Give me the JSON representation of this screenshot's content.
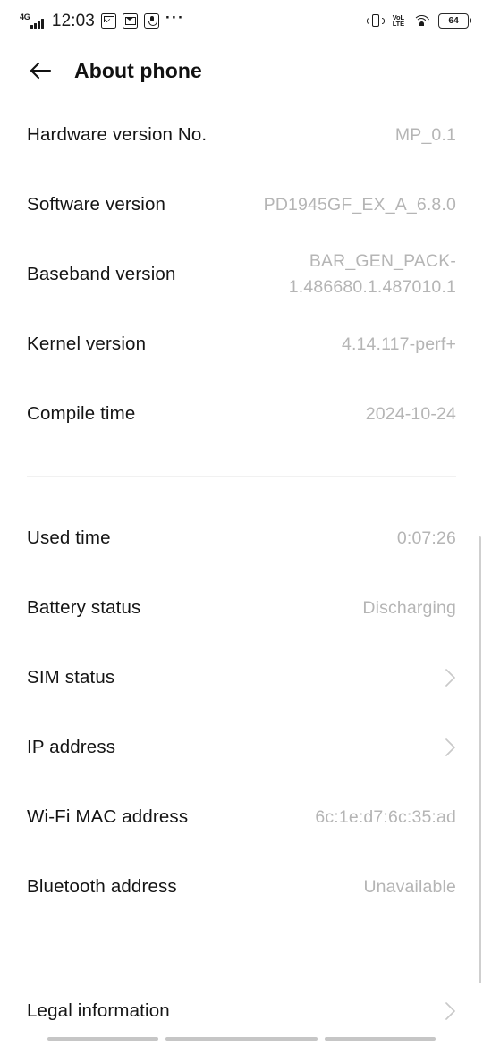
{
  "statusbar": {
    "network_label": "4G",
    "time": "12:03",
    "overflow": "···",
    "volte_top": "VoL",
    "volte_bottom": "LTE",
    "battery_level": "64",
    "icons": {
      "signal": "signal-bars-icon",
      "mail_unread": "mail-unread-icon",
      "mail_read": "mail-read-icon",
      "voice_recorder": "microphone-icon",
      "more": "more-notifications-icon",
      "vibrate": "vibrate-icon",
      "volte": "volte-icon",
      "wifi": "wifi-icon",
      "battery": "battery-icon"
    }
  },
  "appbar": {
    "back_label": "back-arrow",
    "title": "About phone"
  },
  "sections": [
    {
      "id": "version-info",
      "rows": [
        {
          "label": "Hardware version No.",
          "value": "MP_0.1",
          "type": "value"
        },
        {
          "label": "Software version",
          "value": "PD1945GF_EX_A_6.8.0",
          "type": "value"
        },
        {
          "label": "Baseband version",
          "value": "BAR_GEN_PACK-1.486680.1.487010.1",
          "type": "value",
          "wrap": true
        },
        {
          "label": "Kernel version",
          "value": "4.14.117-perf+",
          "type": "value"
        },
        {
          "label": "Compile time",
          "value": "2024-10-24",
          "type": "value"
        }
      ]
    },
    {
      "id": "device-status",
      "rows": [
        {
          "label": "Used time",
          "value": "0:07:26",
          "type": "value"
        },
        {
          "label": "Battery status",
          "value": "Discharging",
          "type": "value"
        },
        {
          "label": "SIM status",
          "value": "",
          "type": "nav"
        },
        {
          "label": "IP address",
          "value": "",
          "type": "nav"
        },
        {
          "label": "Wi-Fi  MAC  address",
          "value": "6c:1e:d7:6c:35:ad",
          "type": "value"
        },
        {
          "label": "Bluetooth address",
          "value": "Unavailable",
          "type": "value"
        }
      ]
    },
    {
      "id": "legal",
      "rows": [
        {
          "label": "Legal information",
          "value": "",
          "type": "nav"
        }
      ]
    }
  ],
  "navbar": {
    "recents": "recents-button",
    "home": "home-button",
    "back": "back-button"
  },
  "colors": {
    "label": "#141414",
    "value": "#b5b5b5",
    "divider": "#f1f1f1",
    "scrollbar": "#cfcfcf",
    "background": "#ffffff"
  }
}
